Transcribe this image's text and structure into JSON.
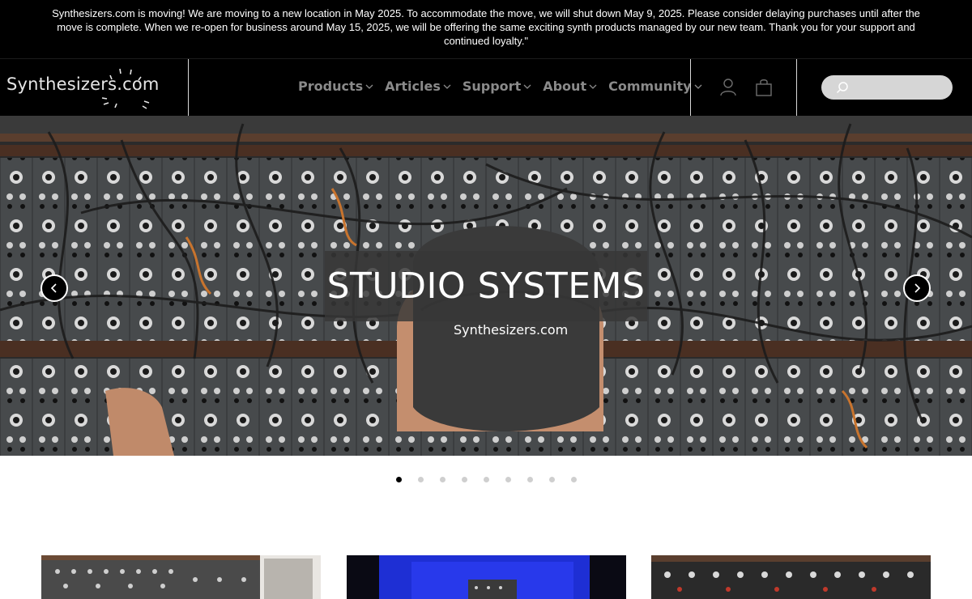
{
  "announcement": "Synthesizers.com is moving! We are moving to a new location in May 2025. To accommodate the move, we will shut down May 9, 2025. Please consider delaying purchases until after the move is complete. When we re-open for business around May 15, 2025, we will be offering the same exciting synth products managed by our new team. Thank you for your support and continued loyalty.\"",
  "header": {
    "logo_text": "Synthesizers.com",
    "nav": [
      {
        "label": "Products"
      },
      {
        "label": "Articles"
      },
      {
        "label": "Support"
      },
      {
        "label": "About"
      },
      {
        "label": "Community"
      }
    ],
    "icons": {
      "account": "user-icon",
      "cart": "shopping-bag-icon",
      "search": "search-icon"
    },
    "search_placeholder": ""
  },
  "hero": {
    "title": "STUDIO SYSTEMS",
    "cap_text": "Synthesizers.com",
    "prev_icon": "chevron-left-icon",
    "next_icon": "chevron-right-icon"
  },
  "carousel": {
    "slides": 9,
    "active": 1
  },
  "colors": {
    "bar": "#000000",
    "nav_text": "#8a8a8a",
    "search_bg": "#d6d6d6",
    "accent_cable": "#c8742e"
  }
}
